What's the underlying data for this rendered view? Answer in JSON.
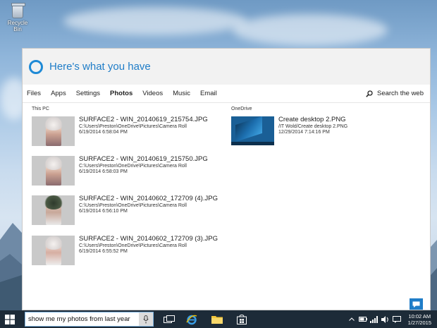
{
  "desktop": {
    "recycle_bin_label": "Recycle Bin"
  },
  "cortana": {
    "title": "Here's what you have",
    "tabs": [
      {
        "label": "Files",
        "active": false
      },
      {
        "label": "Apps",
        "active": false
      },
      {
        "label": "Settings",
        "active": false
      },
      {
        "label": "Photos",
        "active": true
      },
      {
        "label": "Videos",
        "active": false
      },
      {
        "label": "Music",
        "active": false
      },
      {
        "label": "Email",
        "active": false
      }
    ],
    "search_web_label": "Search the web",
    "this_pc": {
      "label": "This PC",
      "results": [
        {
          "name": "SURFACE2 - WIN_20140619_215754.JPG",
          "path": "C:\\Users\\Preston\\OneDrive\\Pictures\\Camera Roll",
          "date": "6/19/2014 6:58:04 PM"
        },
        {
          "name": "SURFACE2 - WIN_20140619_215750.JPG",
          "path": "C:\\Users\\Preston\\OneDrive\\Pictures\\Camera Roll",
          "date": "6/19/2014 6:58:03 PM"
        },
        {
          "name": "SURFACE2 - WIN_20140602_172709 (4).JPG",
          "path": "C:\\Users\\Preston\\OneDrive\\Pictures\\Camera Roll",
          "date": "6/19/2014 6:56:10 PM"
        },
        {
          "name": "SURFACE2 - WIN_20140602_172709 (3).JPG",
          "path": "C:\\Users\\Preston\\OneDrive\\Pictures\\Camera Roll",
          "date": "6/19/2014 6:55:52 PM"
        }
      ]
    },
    "onedrive": {
      "label": "OneDrive",
      "results": [
        {
          "name": "Create desktop 2.PNG",
          "path": "/IT Wold/Create desktop 2.PNG",
          "date": "12/29/2014 7:14:16 PM"
        }
      ]
    }
  },
  "taskbar": {
    "search_value": "show me my photos from last year",
    "time": "10:02 AM",
    "date": "1/27/2015"
  },
  "colors": {
    "accent": "#1f7dc8",
    "taskbar": "#1d2b38"
  }
}
